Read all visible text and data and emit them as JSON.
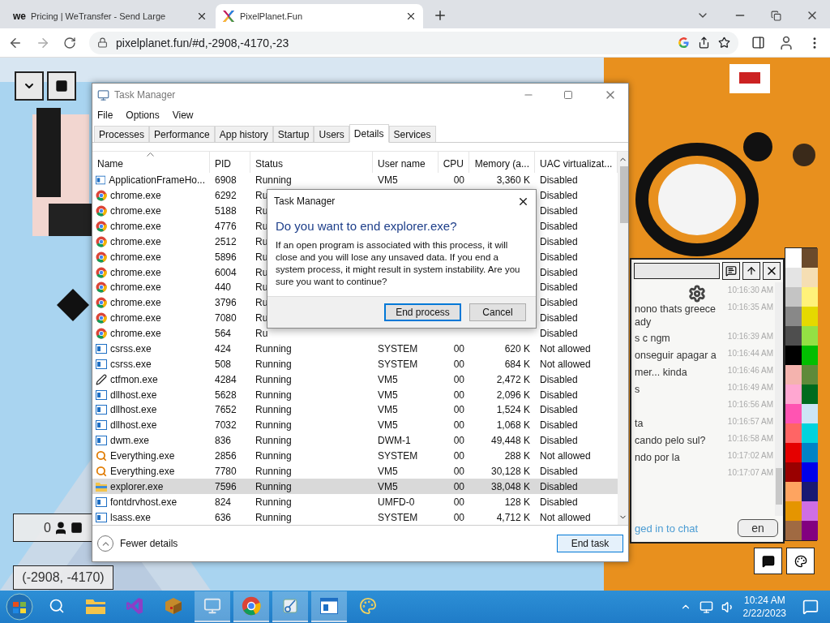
{
  "browser": {
    "tabs": [
      {
        "logo": "we",
        "title": "Pricing | WeTransfer - Send Large",
        "selected": false
      },
      {
        "title": "PixelPlanet.Fun",
        "selected": true
      }
    ],
    "url": "pixelplanet.fun/#d,-2908,-4170,-23"
  },
  "canvas": {
    "online_count": "0",
    "coordinates": "(-2908, -4170)"
  },
  "task_manager": {
    "title": "Task Manager",
    "menu": [
      "File",
      "Options",
      "View"
    ],
    "tabs": [
      {
        "label": "Processes",
        "selected": false
      },
      {
        "label": "Performance",
        "selected": false
      },
      {
        "label": "App history",
        "selected": false
      },
      {
        "label": "Startup",
        "selected": false
      },
      {
        "label": "Users",
        "selected": false
      },
      {
        "label": "Details",
        "selected": true
      },
      {
        "label": "Services",
        "selected": false
      }
    ],
    "columns": [
      {
        "label": "Name",
        "sorted": true
      },
      {
        "label": "PID",
        "sorted": false
      },
      {
        "label": "Status",
        "sorted": false
      },
      {
        "label": "User name",
        "sorted": false
      },
      {
        "label": "CPU",
        "sorted": false
      },
      {
        "label": "Memory (a...",
        "sorted": false
      },
      {
        "label": "UAC virtualizat...",
        "sorted": false
      }
    ],
    "rows": [
      {
        "kind": "app",
        "name": "ApplicationFrameHo...",
        "pid": "6908",
        "status": "Running",
        "user": "VM5",
        "cpu": "00",
        "memory": "3,360 K",
        "uac": "Disabled",
        "selected": false
      },
      {
        "kind": "chrome",
        "name": "chrome.exe",
        "pid": "6292",
        "status": "Ru",
        "uac": "Disabled",
        "selected": false
      },
      {
        "kind": "chrome",
        "name": "chrome.exe",
        "pid": "5188",
        "status": "Ru",
        "uac": "Disabled",
        "selected": false
      },
      {
        "kind": "chrome",
        "name": "chrome.exe",
        "pid": "4776",
        "status": "Ru",
        "uac": "Disabled",
        "selected": false
      },
      {
        "kind": "chrome",
        "name": "chrome.exe",
        "pid": "2512",
        "status": "Ru",
        "uac": "Disabled",
        "selected": false
      },
      {
        "kind": "chrome",
        "name": "chrome.exe",
        "pid": "5896",
        "status": "Ru",
        "uac": "Disabled",
        "selected": false
      },
      {
        "kind": "chrome",
        "name": "chrome.exe",
        "pid": "6004",
        "status": "Ru",
        "uac": "Disabled",
        "selected": false
      },
      {
        "kind": "chrome",
        "name": "chrome.exe",
        "pid": "440",
        "status": "Ru",
        "uac": "Disabled",
        "selected": false
      },
      {
        "kind": "chrome",
        "name": "chrome.exe",
        "pid": "3796",
        "status": "Ru",
        "uac": "Disabled",
        "selected": false
      },
      {
        "kind": "chrome",
        "name": "chrome.exe",
        "pid": "7080",
        "status": "Ru",
        "uac": "Disabled",
        "selected": false
      },
      {
        "kind": "chrome",
        "name": "chrome.exe",
        "pid": "564",
        "status": "Ru",
        "uac": "Disabled",
        "selected": false
      },
      {
        "kind": "app",
        "name": "csrss.exe",
        "pid": "424",
        "status": "Running",
        "user": "SYSTEM",
        "cpu": "00",
        "memory": "620 K",
        "uac": "Not allowed",
        "selected": false
      },
      {
        "kind": "app",
        "name": "csrss.exe",
        "pid": "508",
        "status": "Running",
        "user": "SYSTEM",
        "cpu": "00",
        "memory": "684 K",
        "uac": "Not allowed",
        "selected": false
      },
      {
        "kind": "pen",
        "name": "ctfmon.exe",
        "pid": "4284",
        "status": "Running",
        "user": "VM5",
        "cpu": "00",
        "memory": "2,472 K",
        "uac": "Disabled",
        "selected": false
      },
      {
        "kind": "app",
        "name": "dllhost.exe",
        "pid": "5628",
        "status": "Running",
        "user": "VM5",
        "cpu": "00",
        "memory": "2,096 K",
        "uac": "Disabled",
        "selected": false
      },
      {
        "kind": "app",
        "name": "dllhost.exe",
        "pid": "7652",
        "status": "Running",
        "user": "VM5",
        "cpu": "00",
        "memory": "1,524 K",
        "uac": "Disabled",
        "selected": false
      },
      {
        "kind": "app",
        "name": "dllhost.exe",
        "pid": "7032",
        "status": "Running",
        "user": "VM5",
        "cpu": "00",
        "memory": "1,068 K",
        "uac": "Disabled",
        "selected": false
      },
      {
        "kind": "app",
        "name": "dwm.exe",
        "pid": "836",
        "status": "Running",
        "user": "DWM-1",
        "cpu": "00",
        "memory": "49,448 K",
        "uac": "Disabled",
        "selected": false
      },
      {
        "kind": "search",
        "name": "Everything.exe",
        "pid": "2856",
        "status": "Running",
        "user": "SYSTEM",
        "cpu": "00",
        "memory": "288 K",
        "uac": "Not allowed",
        "selected": false
      },
      {
        "kind": "search",
        "name": "Everything.exe",
        "pid": "7780",
        "status": "Running",
        "user": "VM5",
        "cpu": "00",
        "memory": "30,128 K",
        "uac": "Disabled",
        "selected": false
      },
      {
        "kind": "folder",
        "name": "explorer.exe",
        "pid": "7596",
        "status": "Running",
        "user": "VM5",
        "cpu": "00",
        "memory": "38,048 K",
        "uac": "Disabled",
        "selected": true
      },
      {
        "kind": "app",
        "name": "fontdrvhost.exe",
        "pid": "824",
        "status": "Running",
        "user": "UMFD-0",
        "cpu": "00",
        "memory": "128 K",
        "uac": "Disabled",
        "selected": false
      },
      {
        "kind": "app",
        "name": "lsass.exe",
        "pid": "636",
        "status": "Running",
        "user": "SYSTEM",
        "cpu": "00",
        "memory": "4,712 K",
        "uac": "Not allowed",
        "selected": false
      }
    ],
    "details_toggle": "Fewer details",
    "end_button": "End task"
  },
  "dialog": {
    "title": "Task Manager",
    "heading": "Do you want to end explorer.exe?",
    "message": "If an open program is associated with this process, it will close and you will lose any unsaved data. If you end a system process, it might result in system instability. Are you sure you want to continue?",
    "buttons": [
      {
        "label": "End process",
        "default": true
      },
      {
        "label": "Cancel",
        "default": false
      }
    ]
  },
  "chat": {
    "messages": [
      {
        "time": "10:16:30 AM"
      },
      {
        "text": "nono thats greece ady",
        "time": "10:16:35 AM"
      },
      {
        "text": "s c ngm",
        "time": "10:16:39 AM"
      },
      {
        "text": "onseguir apagar a",
        "time": "10:16:44 AM"
      },
      {
        "text": "mer... kinda",
        "time": "10:16:46 AM"
      },
      {
        "text": "s",
        "time": "10:16:49 AM"
      },
      {
        "time": "10:16:56 AM"
      },
      {
        "text": "ta",
        "time": "10:16:57 AM"
      },
      {
        "text": "cando pelo sul?",
        "time": "10:16:58 AM"
      },
      {
        "text": "ndo por la",
        "time": "10:17:02 AM"
      },
      {
        "time": "10:17:07 AM"
      }
    ],
    "login_link": "ged in to chat",
    "language": "en"
  },
  "palette": [
    {
      "color": "#ffffff"
    },
    {
      "color": "#6b4a2b"
    },
    {
      "color": "#e4e4e4"
    },
    {
      "color": "#f5deb3"
    },
    {
      "color": "#c4c4c4"
    },
    {
      "color": "#fff27a"
    },
    {
      "color": "#888888"
    },
    {
      "color": "#e5d900"
    },
    {
      "color": "#4e4e4e"
    },
    {
      "color": "#94e044"
    },
    {
      "color": "#000000"
    },
    {
      "color": "#02be01"
    },
    {
      "color": "#f4b3ae"
    },
    {
      "color": "#5f8a3a"
    },
    {
      "color": "#ffa7d1"
    },
    {
      "color": "#006b1e"
    },
    {
      "color": "#ff54b2"
    },
    {
      "color": "#cce5f5"
    },
    {
      "color": "#ff6565"
    },
    {
      "color": "#00d3dd"
    },
    {
      "color": "#e50000"
    },
    {
      "color": "#0083c7"
    },
    {
      "color": "#9a0000"
    },
    {
      "color": "#0000ea"
    },
    {
      "color": "#fea460"
    },
    {
      "color": "#191973"
    },
    {
      "color": "#e59500"
    },
    {
      "color": "#cf6ee4"
    },
    {
      "color": "#a06a42"
    },
    {
      "color": "#820080"
    }
  ],
  "taskbar": {
    "apps": [
      {
        "kind": "folder",
        "active": false
      },
      {
        "kind": "studio",
        "active": false
      },
      {
        "kind": "box",
        "active": false
      },
      {
        "kind": "monitor",
        "active": true
      },
      {
        "kind": "chrome",
        "active": true
      },
      {
        "kind": "snip",
        "active": true
      },
      {
        "kind": "window",
        "active": true
      },
      {
        "kind": "paint",
        "active": false
      }
    ],
    "time": "10:24 AM",
    "date": "2/22/2023"
  }
}
